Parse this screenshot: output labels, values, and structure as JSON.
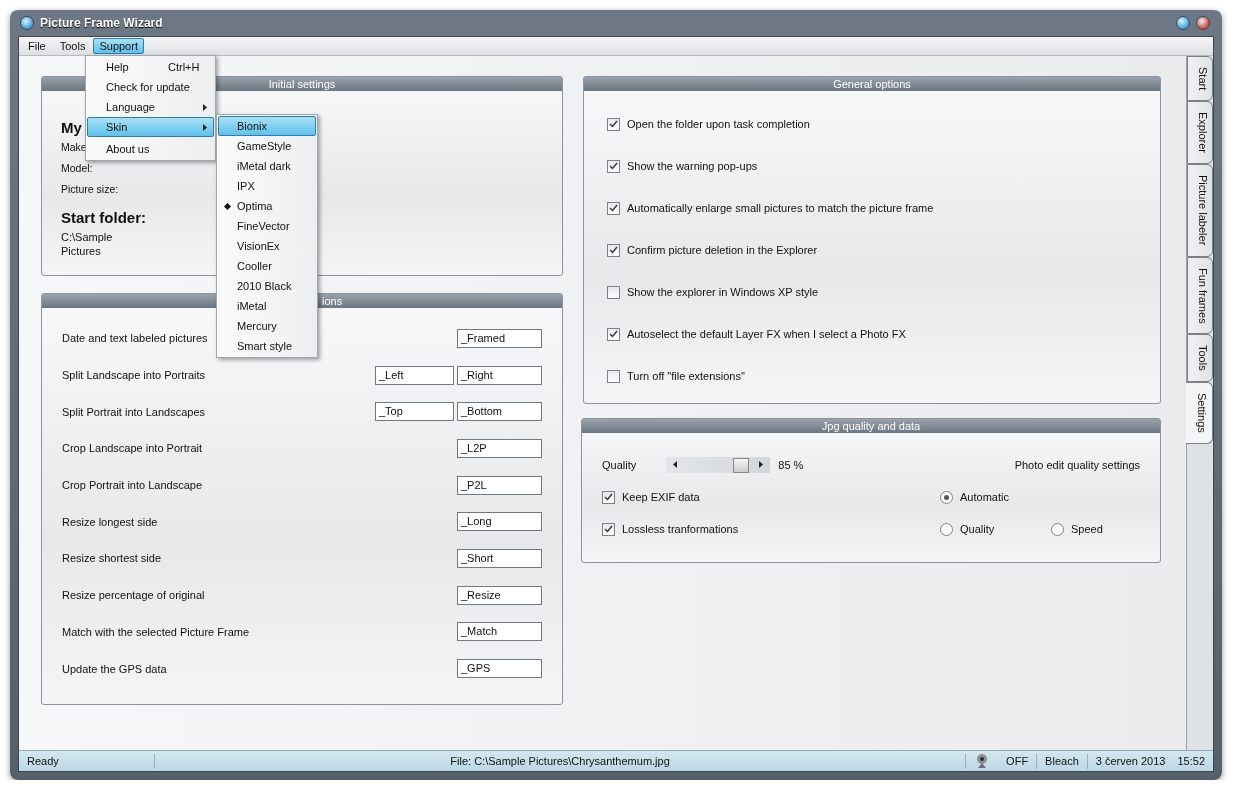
{
  "window": {
    "title": "Picture Frame Wizard"
  },
  "menu_bar": [
    {
      "label": "File",
      "selected": false
    },
    {
      "label": "Tools",
      "selected": false
    },
    {
      "label": "Support",
      "selected": true
    }
  ],
  "support_menu": [
    {
      "label": "Help",
      "shortcut": "Ctrl+H",
      "submenu": false,
      "selected": false
    },
    {
      "label": "Check for update",
      "submenu": false,
      "selected": false
    },
    {
      "label": "Language",
      "submenu": true,
      "selected": false
    },
    {
      "label": "Skin",
      "submenu": true,
      "selected": true
    },
    {
      "label": "About us",
      "submenu": false,
      "selected": false
    }
  ],
  "skin_menu": [
    {
      "label": "Bionix",
      "selected": true,
      "current": false
    },
    {
      "label": "GameStyle",
      "selected": false,
      "current": false
    },
    {
      "label": "iMetal dark",
      "selected": false,
      "current": false
    },
    {
      "label": "IPX",
      "selected": false,
      "current": false
    },
    {
      "label": "Optima",
      "selected": false,
      "current": true
    },
    {
      "label": "FineVector",
      "selected": false,
      "current": false
    },
    {
      "label": "VisionEx",
      "selected": false,
      "current": false
    },
    {
      "label": "Cooller",
      "selected": false,
      "current": false
    },
    {
      "label": "2010 Black",
      "selected": false,
      "current": false
    },
    {
      "label": "iMetal",
      "selected": false,
      "current": false
    },
    {
      "label": "Mercury",
      "selected": false,
      "current": false
    },
    {
      "label": "Smart style",
      "selected": false,
      "current": false
    }
  ],
  "initial_settings": {
    "title": "Initial settings",
    "heading": "My",
    "labels": [
      "Make",
      "Model:",
      "Picture size:"
    ],
    "folder_heading": "Start folder:",
    "folder_lines": [
      "C:\\Sample",
      "Pictures"
    ]
  },
  "suffix_panel": {
    "title": "ions",
    "rows": [
      {
        "label": "Date and text labeled pictures",
        "fields": [
          "_Framed"
        ]
      },
      {
        "label": "Split Landscape into Portraits",
        "fields": [
          "_Left",
          "_Right"
        ]
      },
      {
        "label": "Split Portrait into Landscapes",
        "fields": [
          "_Top",
          "_Bottom"
        ]
      },
      {
        "label": "Crop Landscape into Portrait",
        "fields": [
          "_L2P"
        ]
      },
      {
        "label": "Crop Portrait into Landscape",
        "fields": [
          "_P2L"
        ]
      },
      {
        "label": "Resize longest side",
        "fields": [
          "_Long"
        ]
      },
      {
        "label": "Resize shortest side",
        "fields": [
          "_Short"
        ]
      },
      {
        "label": "Resize percentage of original",
        "fields": [
          "_Resize"
        ]
      },
      {
        "label": "Match with the selected Picture Frame",
        "fields": [
          "_Match"
        ]
      },
      {
        "label": "Update the GPS data",
        "fields": [
          "_GPS"
        ]
      }
    ]
  },
  "general_options": {
    "title": "General options",
    "options": [
      {
        "label": "Open the folder upon task completion",
        "checked": true
      },
      {
        "label": "Show the warning pop-ups",
        "checked": true
      },
      {
        "label": "Automatically enlarge small pictures to match the picture frame",
        "checked": true
      },
      {
        "label": "Confirm picture deletion in the Explorer",
        "checked": true
      },
      {
        "label": "Show the explorer in Windows XP style",
        "checked": false
      },
      {
        "label": "Autoselect the default Layer FX when I select a Photo FX",
        "checked": true
      },
      {
        "label": "Turn off \"file extensions\"",
        "checked": false
      }
    ]
  },
  "jpg_quality": {
    "title": "Jpg quality and data",
    "quality_label": "Quality",
    "level": 0.75,
    "reading": "85 %",
    "photo_edit_label": "Photo edit quality settings",
    "checks": [
      {
        "label": "Keep EXIF data",
        "checked": true
      },
      {
        "label": "Lossless tranformations",
        "checked": true
      }
    ],
    "radios": [
      {
        "label": "Automatic",
        "selected": true
      },
      {
        "label": "Quality",
        "selected": false
      },
      {
        "label": "Speed",
        "selected": false
      }
    ]
  },
  "tabs": [
    {
      "label": "Start",
      "selected": false
    },
    {
      "label": "Explorer",
      "selected": false
    },
    {
      "label": "Picture labeler",
      "selected": false
    },
    {
      "label": "Fun frames",
      "selected": false
    },
    {
      "label": "Tools",
      "selected": false
    },
    {
      "label": "Settings",
      "selected": true
    }
  ],
  "status_bar": {
    "state": "Ready",
    "file": "File: C:\\Sample Pictures\\Chrysanthemum.jpg",
    "toggle": "OFF",
    "skin": "Bleach",
    "date": "3 červen 2013",
    "time": "15:52"
  }
}
